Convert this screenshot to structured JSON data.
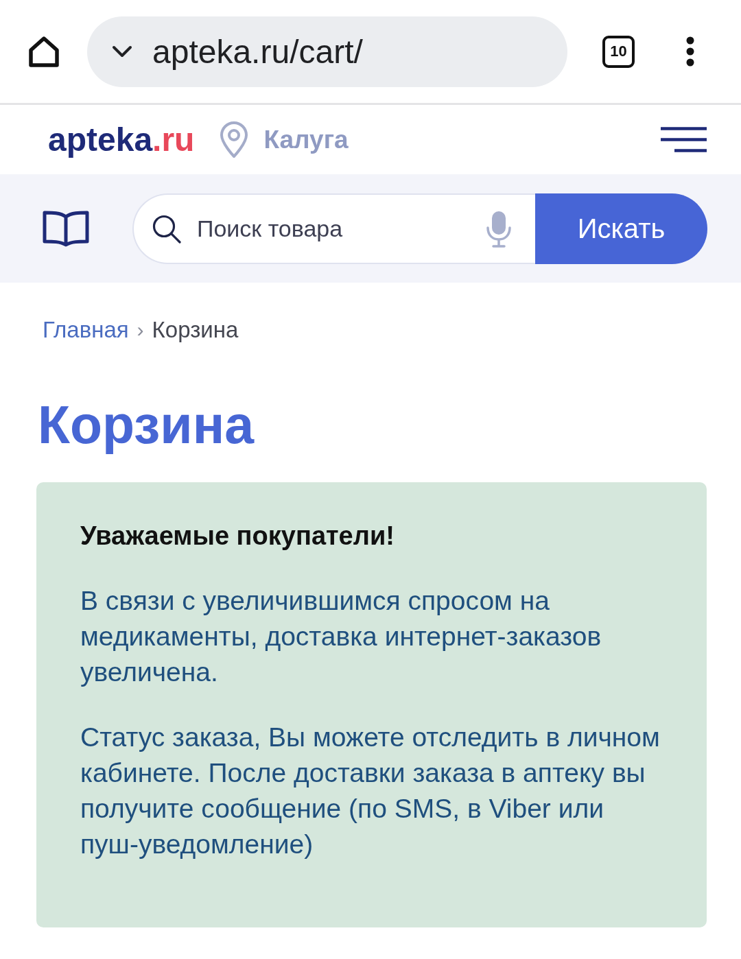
{
  "browser": {
    "url": "apteka.ru/cart/",
    "tab_count": "10"
  },
  "header": {
    "logo": {
      "name": "apteka",
      "suffix": ".ru"
    },
    "city": "Калуга"
  },
  "search": {
    "placeholder": "Поиск товара",
    "button": "Искать"
  },
  "breadcrumbs": {
    "separator": "›",
    "items": [
      {
        "label": "Главная",
        "kind": "link"
      },
      {
        "label": "Корзина",
        "kind": "current"
      }
    ]
  },
  "page_title": "Корзина",
  "notice": {
    "title": "Уважаемые покупатели!",
    "paragraphs": [
      "В связи с увеличившимся спросом на медикаменты, доставка интернет-заказов увеличена.",
      "Статус заказа, Вы можете отследить в личном кабинете. После доставки заказа в аптеку вы получите сообщение (по SMS, в Viber или пуш-уведомление)"
    ]
  }
}
